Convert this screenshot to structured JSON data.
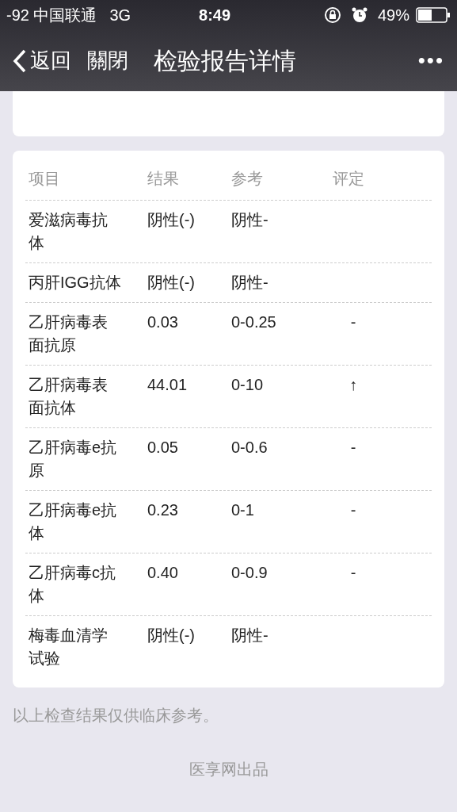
{
  "status_bar": {
    "carrier": "-92 中国联通",
    "network": "3G",
    "time": "8:49",
    "battery": "49%"
  },
  "nav": {
    "back": "返回",
    "close": "關閉",
    "title": "检验报告详情",
    "more": "•••"
  },
  "table": {
    "columns": [
      "项目",
      "结果",
      "参考",
      "评定"
    ],
    "rows": [
      {
        "item": "爱滋病毒抗体",
        "result": "阴性(-)",
        "reference": "阴性-"
      },
      {
        "item": "丙肝IGG抗体",
        "result": "阴性(-)",
        "reference": "阴性-"
      },
      {
        "item": "乙肝病毒表面抗原",
        "result": "0.03",
        "reference": "0-0.25",
        "assessment": "-"
      },
      {
        "item": "乙肝病毒表面抗体",
        "result": "44.01",
        "reference": "0-10",
        "assessment": "↑"
      },
      {
        "item": "乙肝病毒e抗原",
        "result": "0.05",
        "reference": "0-0.6",
        "assessment": "-"
      },
      {
        "item": "乙肝病毒e抗体",
        "result": "0.23",
        "reference": "0-1",
        "assessment": "-"
      },
      {
        "item": "乙肝病毒c抗体",
        "result": "0.40",
        "reference": "0-0.9",
        "assessment": "-"
      },
      {
        "item": "梅毒血清学试验",
        "result": "阴性(-)",
        "reference": "阴性-"
      }
    ]
  },
  "disclaimer": "以上检查结果仅供临床参考。",
  "footer": "医享网出品"
}
